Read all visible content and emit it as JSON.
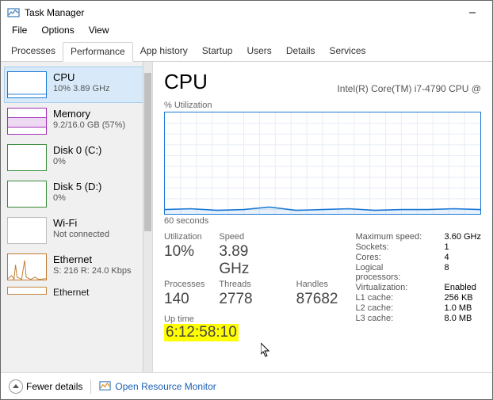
{
  "window": {
    "title": "Task Manager"
  },
  "menu": {
    "file": "File",
    "options": "Options",
    "view": "View"
  },
  "tabs": {
    "processes": "Processes",
    "performance": "Performance",
    "app_history": "App history",
    "startup": "Startup",
    "users": "Users",
    "details": "Details",
    "services": "Services"
  },
  "sidebar": {
    "cpu": {
      "title": "CPU",
      "sub": "10%  3.89 GHz"
    },
    "memory": {
      "title": "Memory",
      "sub": "9.2/16.0 GB (57%)"
    },
    "disk0": {
      "title": "Disk 0 (C:)",
      "sub": "0%"
    },
    "disk5": {
      "title": "Disk 5 (D:)",
      "sub": "0%"
    },
    "wifi": {
      "title": "Wi-Fi",
      "sub": "Not connected"
    },
    "ethernet": {
      "title": "Ethernet",
      "sub": "S: 216 R: 24.0 Kbps"
    },
    "ethernet2": {
      "title": "Ethernet",
      "sub": ""
    }
  },
  "main": {
    "title": "CPU",
    "subtitle": "Intel(R) Core(TM) i7-4790 CPU @",
    "yaxis_label": "% Utilization",
    "xaxis_label": "60 seconds",
    "stats": {
      "utilization_label": "Utilization",
      "utilization": "10%",
      "speed_label": "Speed",
      "speed": "3.89 GHz",
      "processes_label": "Processes",
      "processes": "140",
      "threads_label": "Threads",
      "threads": "2778",
      "handles_label": "Handles",
      "handles": "87682",
      "uptime_label": "Up time",
      "uptime": "6:12:58:10"
    },
    "right": {
      "max_speed_label": "Maximum speed:",
      "max_speed": "3.60 GHz",
      "sockets_label": "Sockets:",
      "sockets": "1",
      "cores_label": "Cores:",
      "cores": "4",
      "lprocs_label": "Logical processors:",
      "lprocs": "8",
      "virt_label": "Virtualization:",
      "virt": "Enabled",
      "l1_label": "L1 cache:",
      "l1": "256 KB",
      "l2_label": "L2 cache:",
      "l2": "1.0 MB",
      "l3_label": "L3 cache:",
      "l3": "8.0 MB"
    }
  },
  "footer": {
    "fewer_details": "Fewer details",
    "resource_monitor": "Open Resource Monitor"
  },
  "chart_data": {
    "type": "line",
    "title": "CPU % Utilization",
    "xlabel": "60 seconds",
    "ylabel": "% Utilization",
    "ylim": [
      0,
      100
    ],
    "x": [
      0,
      5,
      10,
      15,
      20,
      25,
      30,
      35,
      40,
      45,
      50,
      55,
      60
    ],
    "series": [
      {
        "name": "CPU",
        "values": [
          10,
          11,
          9,
          10,
          12,
          9,
          10,
          11,
          9,
          10,
          10,
          11,
          10
        ]
      }
    ]
  }
}
